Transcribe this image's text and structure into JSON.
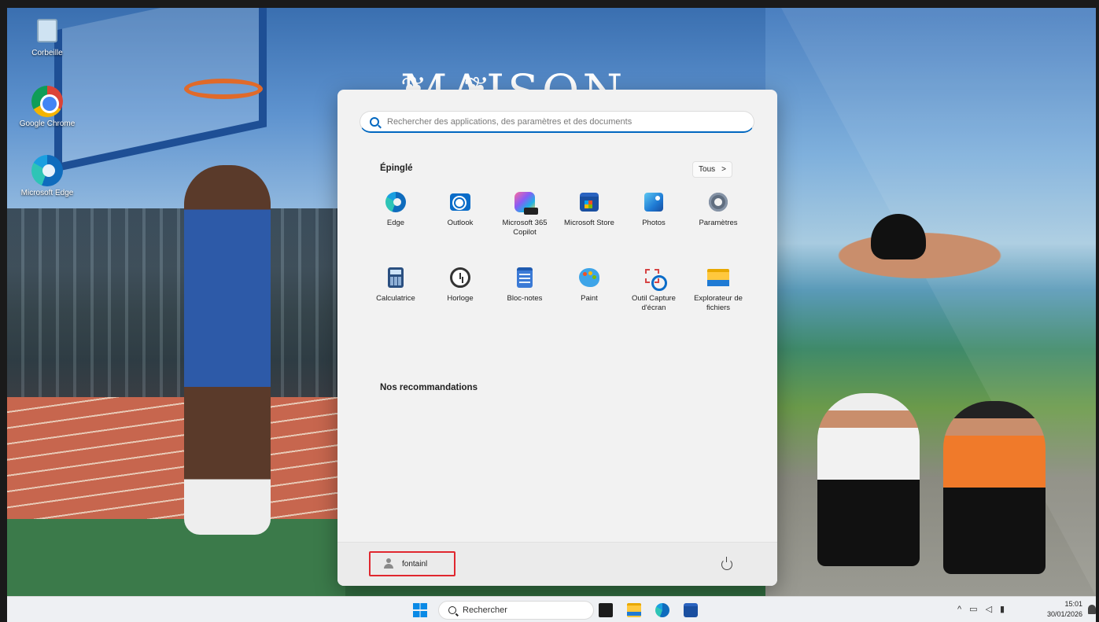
{
  "desktop": {
    "icons": [
      {
        "label": "Corbeille",
        "icon": "recycle-bin-icon"
      },
      {
        "label": "Google Chrome",
        "icon": "chrome-icon"
      },
      {
        "label": "Microsoft Edge",
        "icon": "edge-icon"
      }
    ],
    "wallpaper_text": "MAISON"
  },
  "start_menu": {
    "search_placeholder": "Rechercher des applications, des paramètres et des documents",
    "pinned_title": "Épinglé",
    "all_button": "Tous",
    "all_chevron": ">",
    "pinned": [
      {
        "label": "Edge",
        "icon": "edge-icon"
      },
      {
        "label": "Outlook",
        "icon": "outlook-icon"
      },
      {
        "label": "Microsoft 365 Copilot",
        "icon": "copilot-icon"
      },
      {
        "label": "Microsoft Store",
        "icon": "store-icon"
      },
      {
        "label": "Photos",
        "icon": "photos-icon"
      },
      {
        "label": "Paramètres",
        "icon": "settings-gear-icon"
      },
      {
        "label": "Calculatrice",
        "icon": "calculator-icon"
      },
      {
        "label": "Horloge",
        "icon": "clock-icon"
      },
      {
        "label": "Bloc-notes",
        "icon": "notepad-icon"
      },
      {
        "label": "Paint",
        "icon": "paint-icon"
      },
      {
        "label": "Outil Capture d'écran",
        "icon": "snipping-tool-icon"
      },
      {
        "label": "Explorateur de fichiers",
        "icon": "file-explorer-icon"
      }
    ],
    "recommendations_title": "Nos recommandations",
    "user_name": "fontainl",
    "highlight_color": "#e0272f"
  },
  "taskbar": {
    "search_label": "Rechercher",
    "time": "15:01",
    "date": "30/01/2026",
    "tray_chevron": "^"
  },
  "colors": {
    "accent": "#0067c0",
    "start_bg": "#f2f2f2"
  }
}
